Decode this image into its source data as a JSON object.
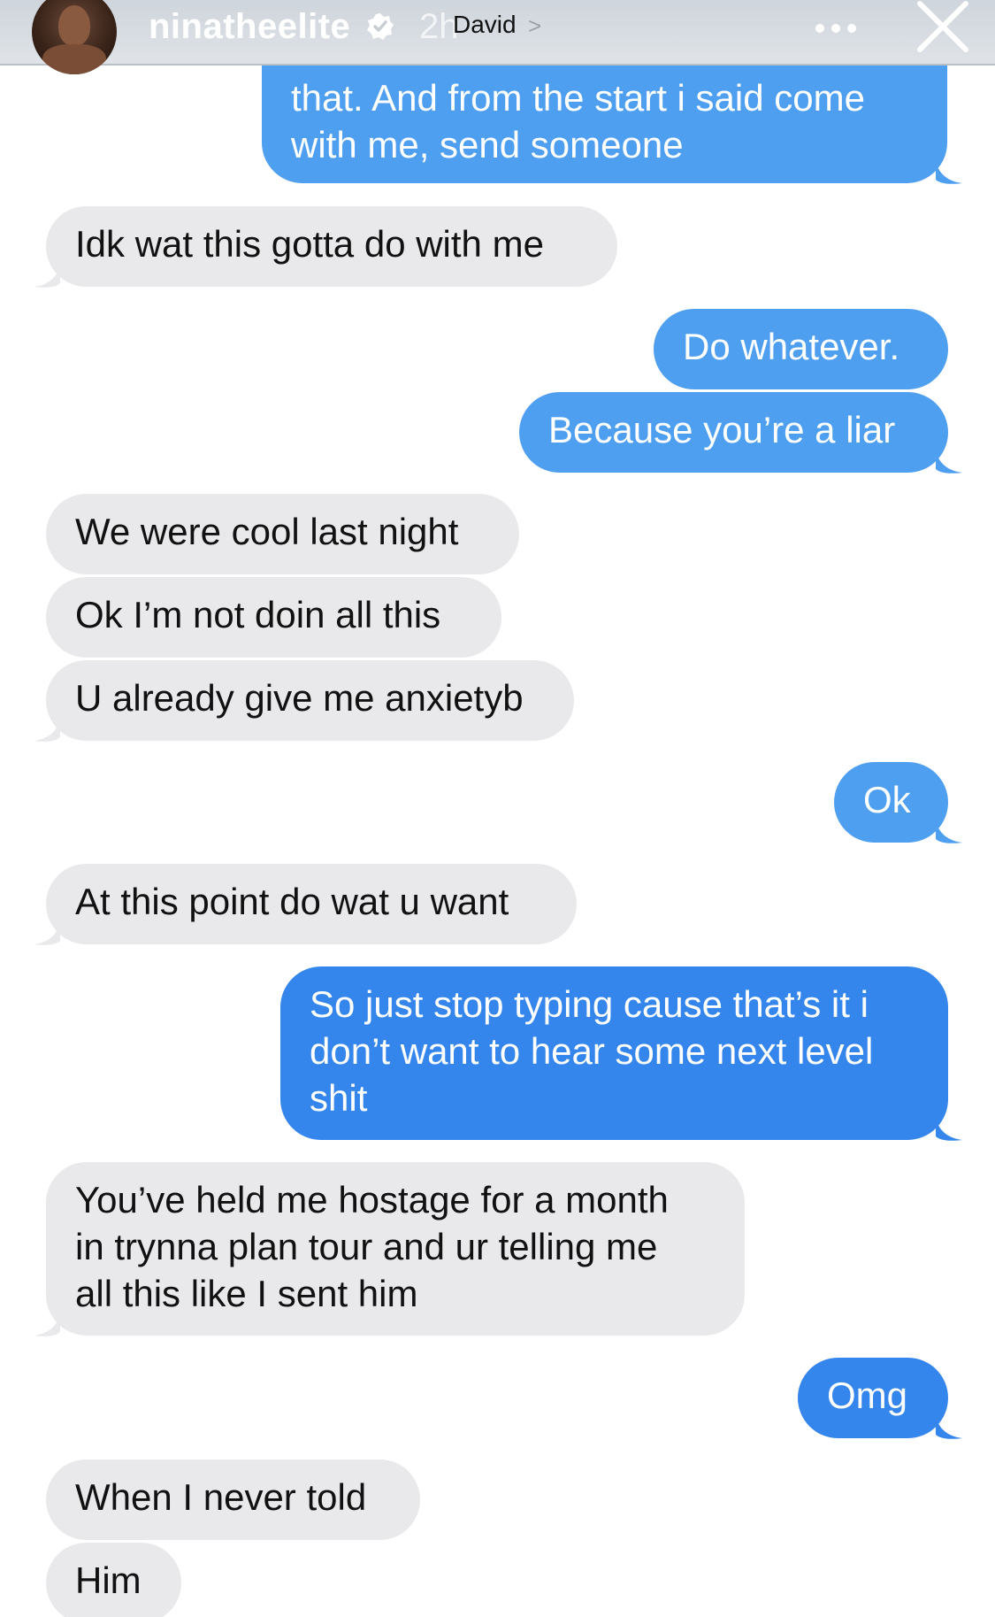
{
  "story_header": {
    "username": "ninatheelite",
    "time_ago": "2h",
    "contact_name": "David",
    "contact_chevron": ">",
    "icons": [
      "verified-badge-icon",
      "more-icon",
      "close-icon",
      "chevron-right-icon"
    ]
  },
  "messages": [
    {
      "side": "out",
      "text": "that. And from the start i said come\nwith me, send someone"
    },
    {
      "side": "in",
      "text": "Idk wat this gotta do with me"
    },
    {
      "side": "out",
      "text": "Do whatever."
    },
    {
      "side": "out",
      "text": "Because you’re a liar"
    },
    {
      "side": "in",
      "text": "We were cool last night"
    },
    {
      "side": "in",
      "text": "Ok I’m not doin all this"
    },
    {
      "side": "in",
      "text": "U already give me anxietyb"
    },
    {
      "side": "out",
      "text": "Ok"
    },
    {
      "side": "in",
      "text": "At this point do wat u want"
    },
    {
      "side": "out",
      "text": "So just stop typing cause that’s it i\ndon’t want to hear some next level\nshit"
    },
    {
      "side": "in",
      "text": "You’ve held me hostage for a month\nin trynna plan tour and ur telling me\nall this like I sent him"
    },
    {
      "side": "out",
      "text": "Omg"
    },
    {
      "side": "in",
      "text": "When I never told"
    },
    {
      "side": "in",
      "text": "Him"
    }
  ],
  "colors": {
    "incoming_bubble": "#e9e9eb",
    "outgoing_bubble": "#4f9ff0",
    "outgoing_bubble_strong": "#3586ec"
  }
}
